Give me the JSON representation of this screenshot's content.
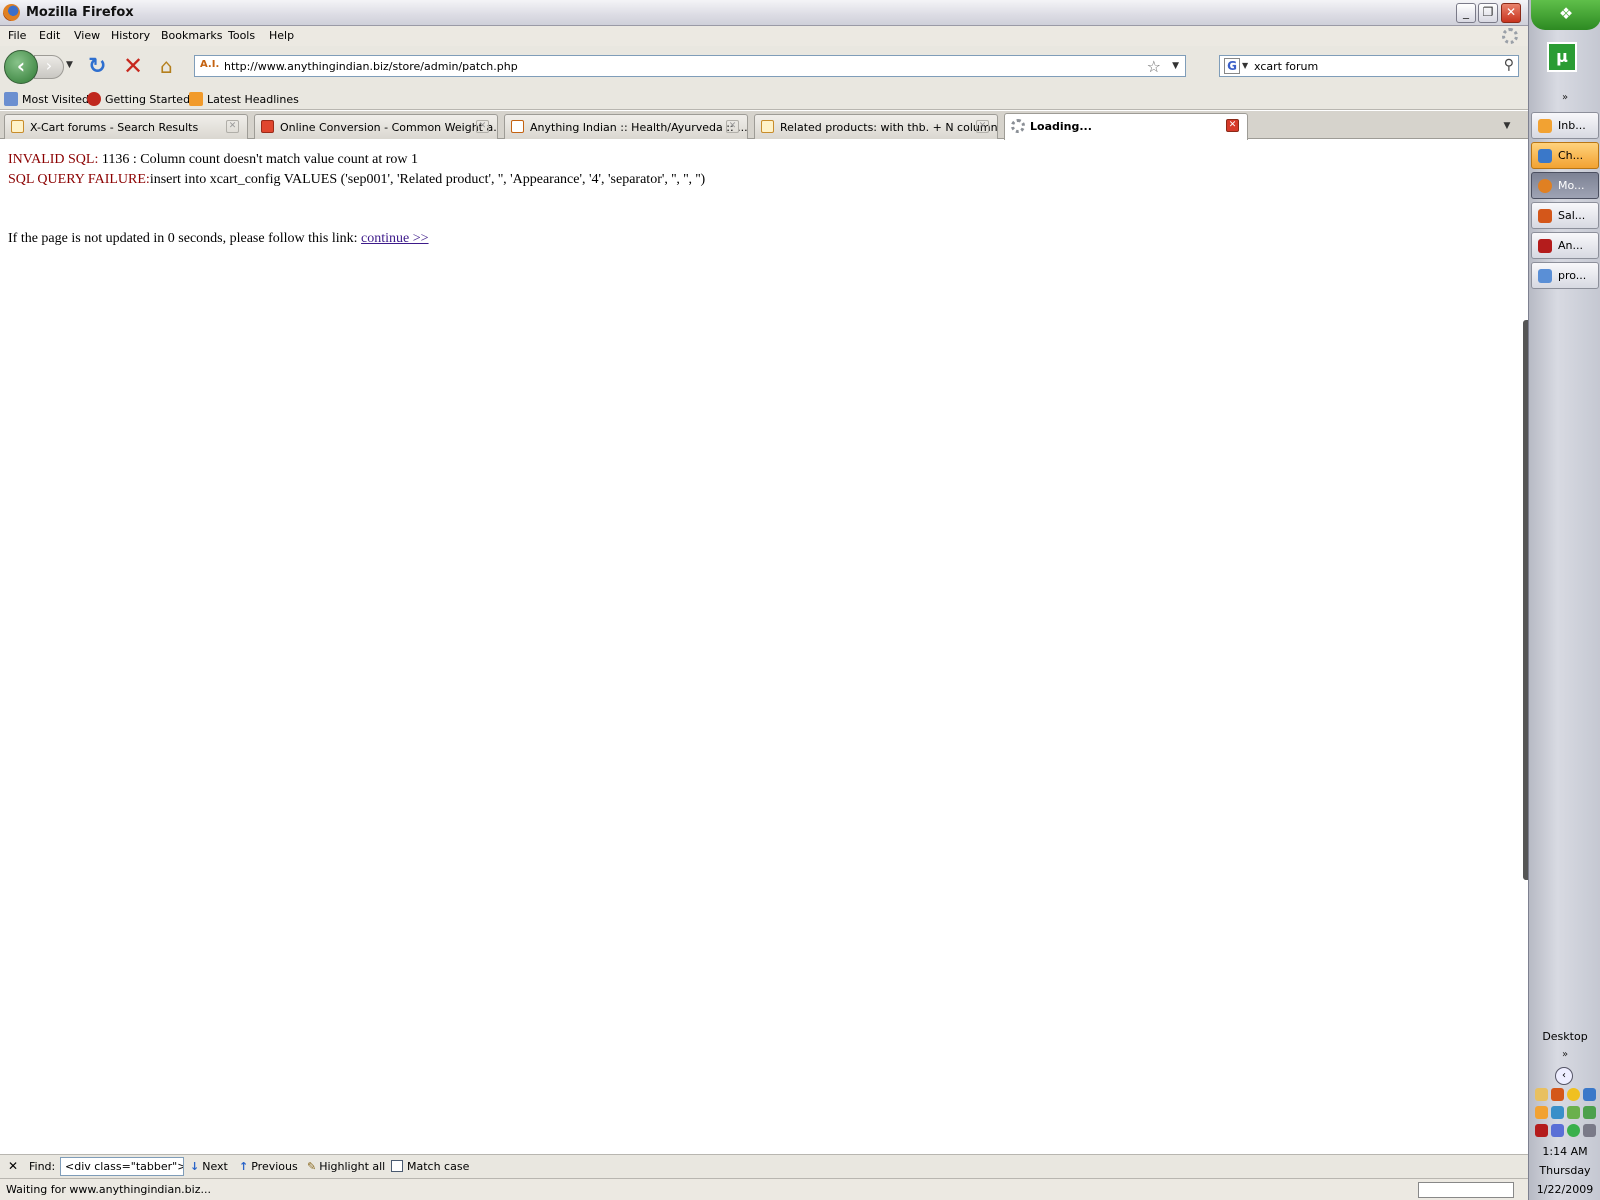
{
  "window": {
    "title": "Mozilla Firefox"
  },
  "menu": [
    "File",
    "Edit",
    "View",
    "History",
    "Bookmarks",
    "Tools",
    "Help"
  ],
  "nav": {
    "url": "http://www.anythingindian.biz/store/admin/patch.php",
    "search": "xcart forum",
    "site_icon": "A.I."
  },
  "bookmarks": [
    "Most Visited",
    "Getting Started",
    "Latest Headlines"
  ],
  "tabs": [
    {
      "label": "X-Cart forums - Search Results"
    },
    {
      "label": "Online Conversion - Common Weight a..."
    },
    {
      "label": "Anything Indian :: Health/Ayurveda :: ..."
    },
    {
      "label": "Related products: with thb. + N column..."
    },
    {
      "label": "Loading..."
    }
  ],
  "page": {
    "invalid_label": "INVALID SQL:",
    "invalid_text": " 1136 : Column count doesn't match value count at row 1",
    "failure_label": "SQL QUERY FAILURE:",
    "failure_text": "insert into xcart_config VALUES ('sep001', 'Related product', '', 'Appearance', '4', 'separator', '', '', '')",
    "redirect_text": "If the page is not updated in 0 seconds, please follow this link: ",
    "redirect_link": "continue >>"
  },
  "findbar": {
    "label": "Find:",
    "value": "<div class=\"tabber\">",
    "next": "Next",
    "previous": "Previous",
    "highlight": "Highlight all",
    "match_case": "Match case"
  },
  "status": "Waiting for www.anythingindian.biz...",
  "taskbar": {
    "buttons": [
      {
        "label": "Inb...",
        "icon_color": "#f2a232"
      },
      {
        "label": "Ch...",
        "icon_color": "#3a78c9"
      },
      {
        "label": "Mo...",
        "icon_color": "#e08022"
      },
      {
        "label": "Sal...",
        "icon_color": "#d4571a"
      },
      {
        "label": "An...",
        "icon_color": "#b41c1c"
      },
      {
        "label": "pro...",
        "icon_color": "#5a8fd6"
      }
    ],
    "desktop": "Desktop",
    "time": "1:14 AM",
    "day": "Thursday",
    "date": "1/22/2009"
  },
  "colors": {
    "error_red": "#8b0000",
    "link": "#3d1a8a",
    "start_green": "#2d8a22",
    "close_red": "#c8341f"
  }
}
